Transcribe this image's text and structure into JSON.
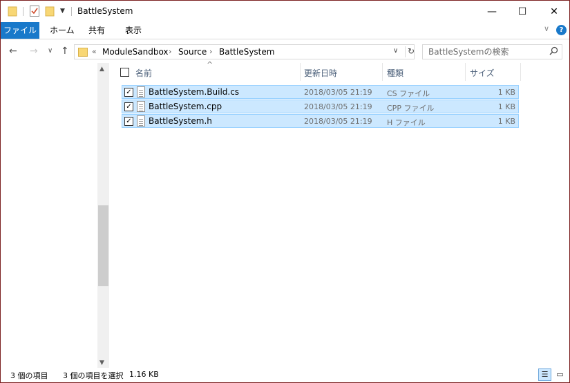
{
  "window": {
    "title": "BattleSystem"
  },
  "title_buttons": {
    "minimize": "—",
    "maximize": "☐",
    "close": "✕"
  },
  "ribbon": {
    "tabs": [
      "ファイル",
      "ホーム",
      "共有",
      "表示"
    ],
    "collapse_glyph": "∨",
    "help_glyph": "?"
  },
  "nav": {
    "back": "←",
    "forward": "→",
    "recent": "∨",
    "up": "↑",
    "overflow": "«",
    "breadcrumbs": [
      "ModuleSandbox",
      "Source",
      "BattleSystem"
    ],
    "separator": "›",
    "dropdown": "∨",
    "refresh": "↻"
  },
  "search": {
    "placeholder": "BattleSystemの検索"
  },
  "columns": {
    "name": "名前",
    "date": "更新日時",
    "type": "種類",
    "size": "サイズ"
  },
  "files": [
    {
      "name": "BattleSystem.Build.cs",
      "date": "2018/03/05 21:19",
      "type": "CS ファイル",
      "size": "1 KB",
      "checked": true
    },
    {
      "name": "BattleSystem.cpp",
      "date": "2018/03/05 21:19",
      "type": "CPP ファイル",
      "size": "1 KB",
      "checked": true
    },
    {
      "name": "BattleSystem.h",
      "date": "2018/03/05 21:19",
      "type": "H ファイル",
      "size": "1 KB",
      "checked": true
    }
  ],
  "status": {
    "item_count": "3 個の項目",
    "selected": "3 個の項目を選択",
    "selected_size": "1.16 KB"
  },
  "colors": {
    "accent": "#1979ca",
    "selection": "#cce8ff",
    "selection_border": "#99d1ff"
  }
}
